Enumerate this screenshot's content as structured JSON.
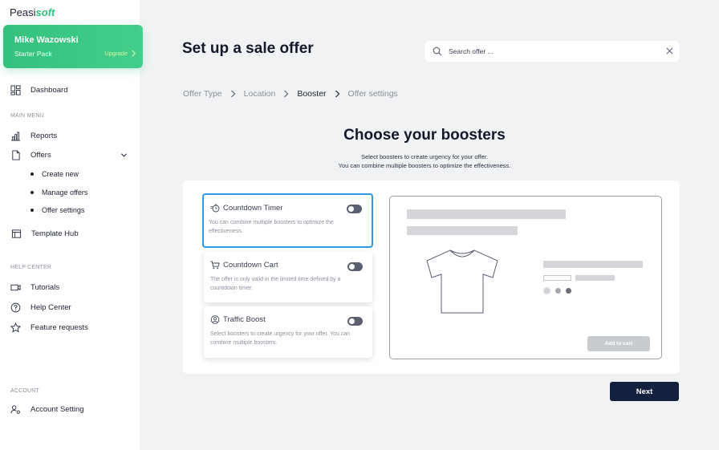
{
  "brand": {
    "name_main": "Peasi",
    "name_accent": "soft",
    "accent_color": "#2ec27e"
  },
  "user": {
    "name": "Mike Wazowski",
    "plan": "Starter Pack",
    "upgrade_label": "Upgrade"
  },
  "sidebar": {
    "dashboard": "Dashboard",
    "main_menu_label": "MAIN MENU",
    "reports": "Reports",
    "offers": "Offers",
    "offers_sub": [
      "Create new",
      "Manage offers",
      "Offer settings"
    ],
    "template_hub": "Template Hub",
    "help_center_label": "HELP CENTER",
    "tutorials": "Tutorials",
    "help_center": "Help Center",
    "feature_requests": "Feature requests",
    "account_label": "ACCOUNT",
    "account_setting": "Account Setting"
  },
  "header": {
    "title": "Set up a sale offer",
    "search_placeholder": "Search offer ..."
  },
  "breadcrumb": [
    "Offer Type",
    "Location",
    "Booster",
    "Offer settings"
  ],
  "boosters_section": {
    "heading": "Choose your boosters",
    "subtitle_1": "Select boosters to create urgency for your offer.",
    "subtitle_2": "You can combine multiple boosters to optimize the effectiveness."
  },
  "boosters": [
    {
      "title": "Countdown Timer",
      "description": "You can combine multiple boosters to optimize the effectiveness.",
      "icon": "timer-icon",
      "selected": true,
      "enabled": false
    },
    {
      "title": "Countdown Cart",
      "description": "The offer is only valid in the limited time defined by a countdown timer.",
      "icon": "cart-icon",
      "selected": false,
      "enabled": false
    },
    {
      "title": "Traffic Boost",
      "description": "Select boosters to create urgency for your offer. You can combine multiple boosters.",
      "icon": "traffic-icon",
      "selected": false,
      "enabled": false
    }
  ],
  "preview": {
    "add_to_cart_label": "Add to cart"
  },
  "actions": {
    "next_label": "Next"
  },
  "colors": {
    "selected_border": "#2d9be6",
    "next_button": "#13203e"
  }
}
